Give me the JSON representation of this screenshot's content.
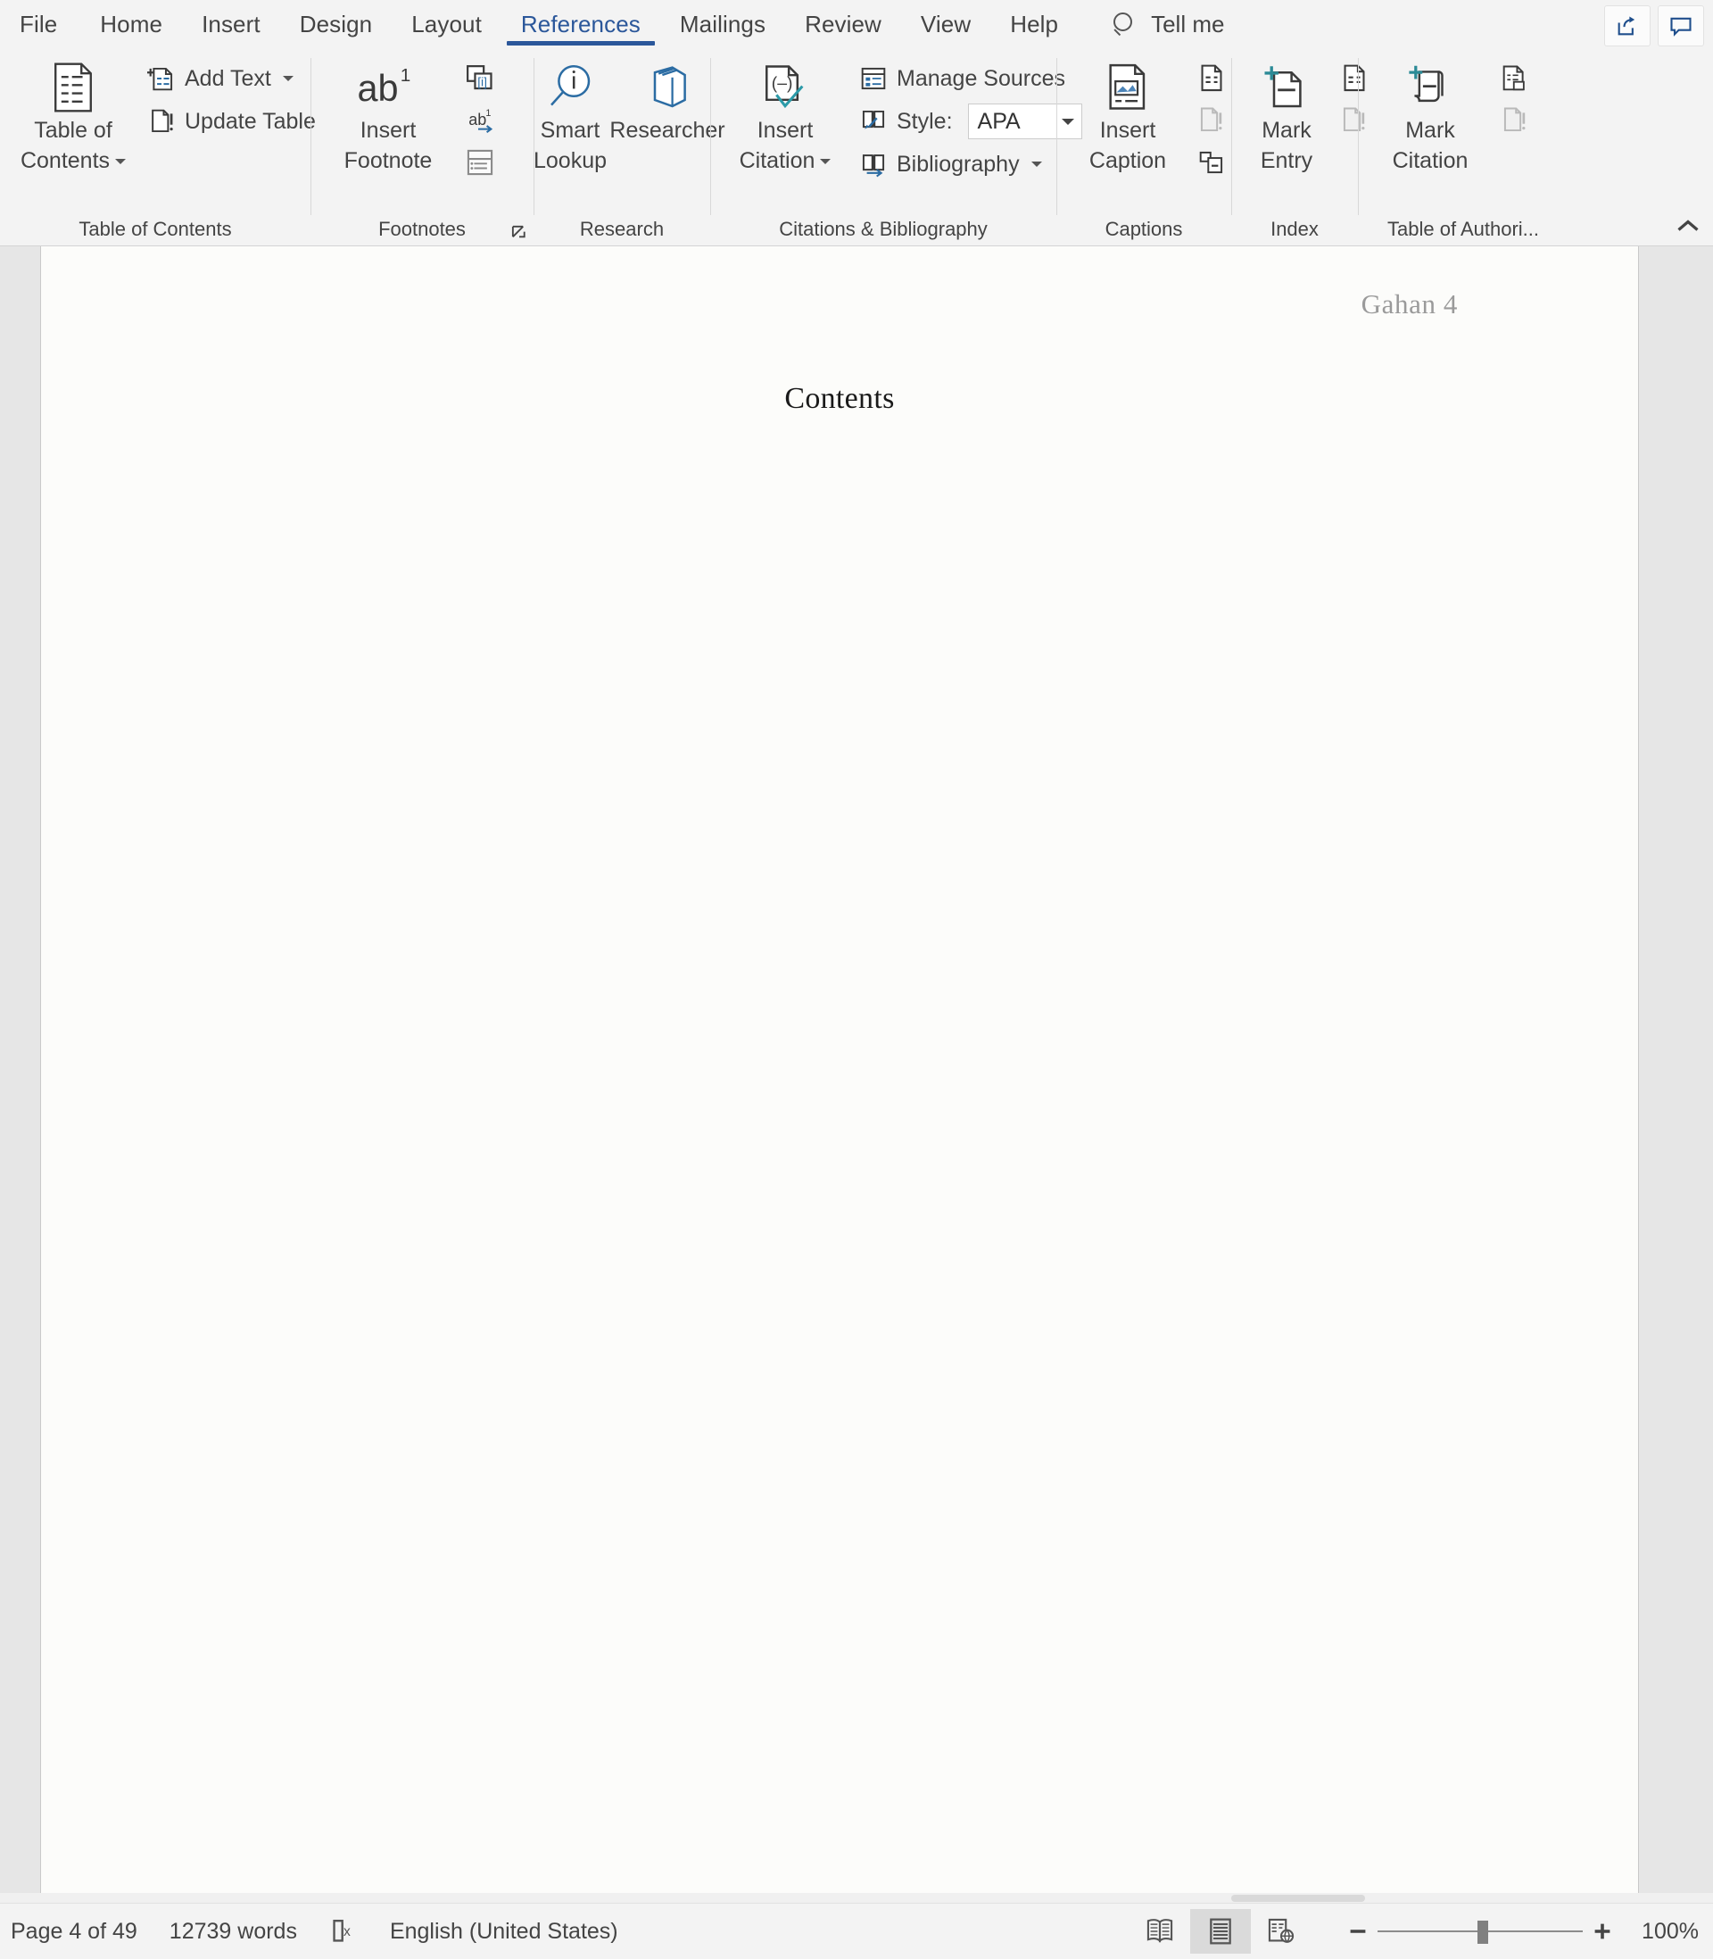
{
  "window": {
    "app": "Word"
  },
  "tabs": [
    {
      "id": "file",
      "label": "File",
      "active": false
    },
    {
      "id": "home",
      "label": "Home",
      "active": false
    },
    {
      "id": "insert",
      "label": "Insert",
      "active": false
    },
    {
      "id": "design",
      "label": "Design",
      "active": false
    },
    {
      "id": "layout",
      "label": "Layout",
      "active": false
    },
    {
      "id": "references",
      "label": "References",
      "active": true
    },
    {
      "id": "mailings",
      "label": "Mailings",
      "active": false
    },
    {
      "id": "review",
      "label": "Review",
      "active": false
    },
    {
      "id": "view",
      "label": "View",
      "active": false
    },
    {
      "id": "help",
      "label": "Help",
      "active": false
    }
  ],
  "tellme": {
    "label": "Tell me",
    "icon": "search-icon"
  },
  "topright": {
    "share_icon": "share-icon",
    "comments_icon": "comment-icon"
  },
  "ribbon": {
    "accent": "#2b579a",
    "groups": [
      {
        "id": "table-of-contents",
        "label": "Table of Contents",
        "big": {
          "label_line1": "Table of",
          "label_line2": "Contents",
          "has_caret": true,
          "icon": "table-of-contents-icon"
        },
        "small": [
          {
            "id": "add-text",
            "label": "Add Text",
            "has_caret": true,
            "icon": "add-text-icon"
          },
          {
            "id": "update-table",
            "label": "Update Table",
            "has_caret": false,
            "icon": "update-table-icon"
          }
        ]
      },
      {
        "id": "footnotes",
        "label": "Footnotes",
        "has_dialog_launcher": true,
        "big": {
          "label_line1": "Insert",
          "label_line2": "Footnote",
          "has_caret": false,
          "icon": "insert-footnote-icon"
        },
        "icons": [
          {
            "id": "insert-endnote",
            "icon": "insert-endnote-icon",
            "has_caret": false
          },
          {
            "id": "next-footnote",
            "icon": "next-footnote-icon",
            "has_caret": true
          },
          {
            "id": "show-notes",
            "icon": "show-notes-icon",
            "has_caret": false
          }
        ]
      },
      {
        "id": "research",
        "label": "Research",
        "buttons": [
          {
            "id": "smart-lookup",
            "label_line1": "Smart",
            "label_line2": "Lookup",
            "icon": "smart-lookup-icon"
          },
          {
            "id": "researcher",
            "label_line1": "Researcher",
            "label_line2": "",
            "icon": "researcher-icon"
          }
        ]
      },
      {
        "id": "citations-bibliography",
        "label": "Citations & Bibliography",
        "big": {
          "label_line1": "Insert",
          "label_line2": "Citation",
          "has_caret": true,
          "icon": "insert-citation-icon"
        },
        "small": [
          {
            "id": "manage-sources",
            "label": "Manage Sources",
            "has_caret": false,
            "icon": "manage-sources-icon"
          },
          {
            "id": "style",
            "label": "Style:",
            "has_caret": false,
            "icon": "style-icon"
          },
          {
            "id": "bibliography",
            "label": "Bibliography",
            "has_caret": true,
            "icon": "bibliography-icon"
          }
        ],
        "style_dropdown": {
          "value": "APA"
        }
      },
      {
        "id": "captions",
        "label": "Captions",
        "big": {
          "label_line1": "Insert",
          "label_line2": "Caption",
          "has_caret": false,
          "icon": "insert-caption-icon"
        },
        "icons": [
          {
            "id": "insert-table-of-figures",
            "icon": "insert-table-of-figures-icon",
            "disabled": false
          },
          {
            "id": "update-table-figures",
            "icon": "update-table-figures-icon",
            "disabled": true
          },
          {
            "id": "cross-reference",
            "icon": "cross-reference-icon",
            "disabled": false
          }
        ]
      },
      {
        "id": "index",
        "label": "Index",
        "big": {
          "label_line1": "Mark",
          "label_line2": "Entry",
          "has_caret": false,
          "icon": "mark-entry-icon"
        },
        "icons": [
          {
            "id": "insert-index",
            "icon": "insert-index-icon",
            "disabled": false
          },
          {
            "id": "update-index",
            "icon": "update-index-icon",
            "disabled": true
          }
        ]
      },
      {
        "id": "table-of-authorities",
        "label": "Table of Authori...",
        "big": {
          "label_line1": "Mark",
          "label_line2": "Citation",
          "has_caret": false,
          "icon": "mark-citation-icon"
        },
        "icons": [
          {
            "id": "insert-table-of-authorities",
            "icon": "insert-table-of-authorities-icon",
            "disabled": false
          },
          {
            "id": "update-table-of-authorities",
            "icon": "update-table-of-authorities-icon",
            "disabled": true
          }
        ]
      }
    ],
    "collapse_icon": "chevron-up-icon"
  },
  "document": {
    "header_text": "Gahan 4",
    "heading": "Contents"
  },
  "statusbar": {
    "page": "Page 4 of 49",
    "words": "12739 words",
    "proofing_icon": "proofing-errors-icon",
    "language": "English (United States)",
    "views": [
      {
        "id": "read-mode",
        "icon": "read-mode-icon",
        "active": false
      },
      {
        "id": "print-layout",
        "icon": "print-layout-icon",
        "active": true
      },
      {
        "id": "web-layout",
        "icon": "web-layout-icon",
        "active": false
      }
    ],
    "zoom_out_label": "−",
    "zoom_in_label": "+",
    "zoom_level": "100%"
  }
}
